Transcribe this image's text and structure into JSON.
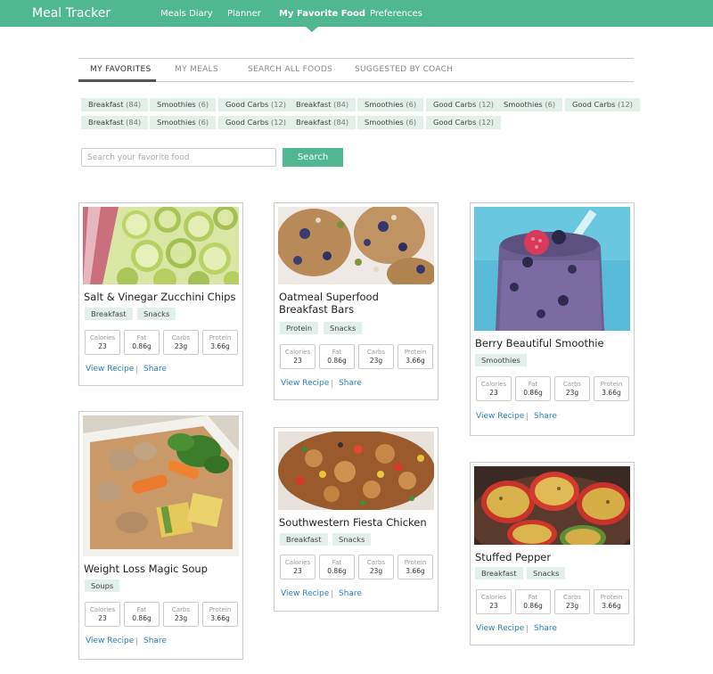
{
  "app": {
    "brand": "Meal Tracker"
  },
  "nav": [
    {
      "label": "Meals Diary"
    },
    {
      "label": "Planner"
    },
    {
      "label": "My Favorite Food",
      "active": true
    },
    {
      "label": "Preferences"
    }
  ],
  "tabs": [
    {
      "label": "MY FAVORITES",
      "active": true
    },
    {
      "label": "MY MEALS"
    },
    {
      "label": "SEARCH ALL FOODS"
    },
    {
      "label": "SUGGESTED BY COACH"
    }
  ],
  "chips": [
    {
      "name": "Breakfast",
      "count": "(84)"
    },
    {
      "name": "Smoothies",
      "count": "(6)"
    },
    {
      "name": "Good Carbs",
      "count": "(12)"
    },
    {
      "name": "Breakfast",
      "count": "(84)"
    },
    {
      "name": "Smoothies",
      "count": "(6)"
    },
    {
      "name": "Good Carbs",
      "count": "(12)"
    },
    {
      "name": "Smoothies",
      "count": "(6)"
    },
    {
      "name": "Good Carbs",
      "count": "(12)"
    },
    {
      "name": "Breakfast",
      "count": "(84)"
    },
    {
      "name": "Smoothies",
      "count": "(6)"
    },
    {
      "name": "Good Carbs",
      "count": "(12)"
    },
    {
      "name": "Breakfast",
      "count": "(84)"
    },
    {
      "name": "Smoothies",
      "count": "(6)"
    },
    {
      "name": "Good Carbs",
      "count": "(12)"
    }
  ],
  "search": {
    "placeholder": "Search your favorite food",
    "button": "Search"
  },
  "nutrition_labels": {
    "calories": "Calories",
    "fat": "Fat",
    "carbs": "Carbs",
    "protein": "Protein"
  },
  "card_links": {
    "view": "View Recipe",
    "share": "Share"
  },
  "cards": [
    {
      "title": "Salt & Vinegar Zucchini Chips",
      "tags": [
        "Breakfast",
        "Snacks"
      ],
      "image": "zucchini-chips-photo",
      "calories": "23",
      "fat": "0.86g",
      "carbs": "23g",
      "protein": "3.66g"
    },
    {
      "title": "Oatmeal Superfood Breakfast Bars",
      "tags": [
        "Protein",
        "Snacks"
      ],
      "image": "oatmeal-bars-photo",
      "calories": "23",
      "fat": "0.86g",
      "carbs": "23g",
      "protein": "3.66g"
    },
    {
      "title": "Berry Beautiful Smoothie",
      "tags": [
        "Smoothies"
      ],
      "image": "berry-smoothie-photo",
      "calories": "23",
      "fat": "0.86g",
      "carbs": "23g",
      "protein": "3.66g"
    },
    {
      "title": "Weight Loss Magic Soup",
      "tags": [
        "Soups"
      ],
      "image": "magic-soup-photo",
      "calories": "23",
      "fat": "0.86g",
      "carbs": "23g",
      "protein": "3.66g"
    },
    {
      "title": "Southwestern Fiesta Chicken",
      "tags": [
        "Breakfast",
        "Snacks"
      ],
      "image": "fiesta-chicken-photo",
      "calories": "23",
      "fat": "0.86g",
      "carbs": "23g",
      "protein": "3.66g"
    },
    {
      "title": "Stuffed Pepper",
      "tags": [
        "Breakfast",
        "Snacks"
      ],
      "image": "stuffed-pepper-photo",
      "calories": "23",
      "fat": "0.86g",
      "carbs": "23g",
      "protein": "3.66g"
    }
  ],
  "colors": {
    "brand": "#4fb893",
    "chip_bg": "#e3efe9",
    "link": "#2a7fc0"
  }
}
